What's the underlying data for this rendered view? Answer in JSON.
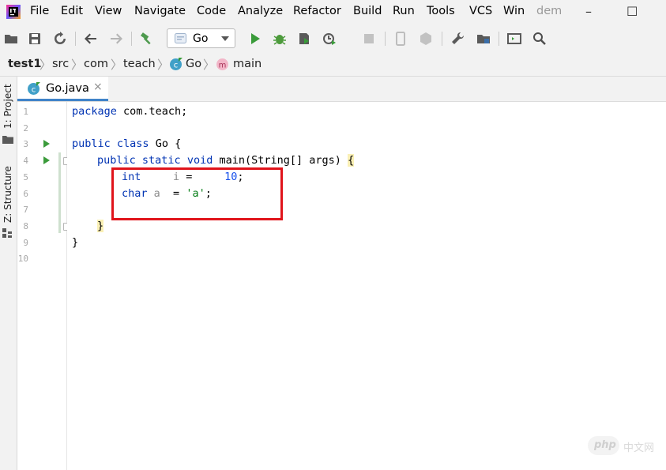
{
  "menu": {
    "items": [
      "File",
      "Edit",
      "View",
      "Navigate",
      "Code",
      "Analyze",
      "Refactor",
      "Build",
      "Run",
      "Tools",
      "VCS",
      "Win"
    ],
    "project_hint": "dem"
  },
  "window_controls": {
    "minimize": "–",
    "maximize": "☐"
  },
  "toolbar": {
    "run_config": "Go",
    "icons": [
      "open-folder-icon",
      "save-icon",
      "sync-icon",
      "back-arrow-icon",
      "forward-arrow-icon",
      "hammer-build-icon",
      "run-icon",
      "debug-icon",
      "coverage-icon",
      "profile-icon",
      "stop-icon",
      "device-icon",
      "sdk-icon",
      "wrench-settings-icon",
      "project-structure-icon",
      "terminal-icon",
      "search-icon"
    ]
  },
  "breadcrumb": {
    "project": "test1",
    "items": [
      "src",
      "com",
      "teach",
      "Go",
      "main"
    ],
    "sep": "〉"
  },
  "tool_windows": {
    "project": "1: Project",
    "structure": "Z: Structure"
  },
  "tab": {
    "label": "Go.java",
    "close": "×"
  },
  "editor": {
    "line_numbers": [
      "1",
      "2",
      "3",
      "4",
      "5",
      "6",
      "7",
      "8",
      "9",
      "10"
    ],
    "lines": {
      "l1_kw": "package",
      "l1_rest": " com.teach;",
      "l3_kw1": "public",
      "l3_kw2": "class",
      "l3_rest": " Go {",
      "l4_kw1": "public",
      "l4_kw2": "static",
      "l4_kw3": "void",
      "l4_rest": " main(String[] args) ",
      "l4_brace": "{",
      "l5_kw": "int",
      "l5_var": "i",
      "l5_eq": " =",
      "l5_num": "10",
      "l5_semi": ";",
      "l6_kw": "char",
      "l6_var": "a",
      "l6_eq": "  = ",
      "l6_str": "'a'",
      "l6_semi": ";",
      "l8_brace": "}",
      "l9_brace": "}"
    }
  },
  "watermark": {
    "logo": "php",
    "site": "中文网"
  },
  "colors": {
    "keyword": "#0033b3",
    "number": "#1750eb",
    "string": "#067d17",
    "highlight_box": "#e0141b",
    "run_mark": "#3b9b3b"
  }
}
